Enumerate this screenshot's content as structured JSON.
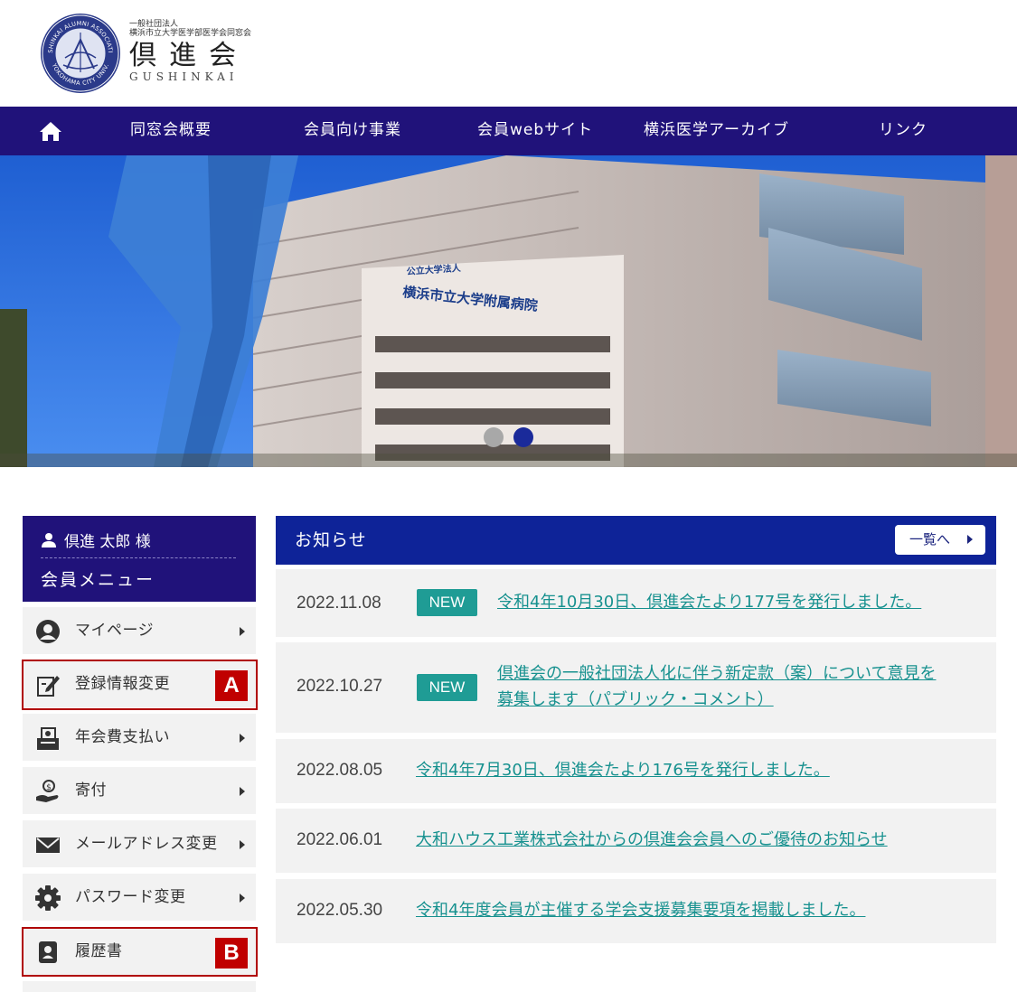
{
  "header": {
    "logo_seal_text_top": "GUSHINKAI ALUMNI ASSOCIATION",
    "logo_seal_text_bottom": "YOKOHAMA CITY UNIV.",
    "logo_sub_line1": "一般社団法人",
    "logo_sub_line2": "横浜市立大学医学部医学会同窓会",
    "logo_main": "倶進会",
    "logo_roman": "GUSHINKAI"
  },
  "nav": {
    "items": [
      {
        "label": "同窓会概要"
      },
      {
        "label": "会員向け事業"
      },
      {
        "label": "会員webサイト"
      },
      {
        "label": "横浜医学アーカイブ"
      },
      {
        "label": "リンク"
      }
    ]
  },
  "hero": {
    "sign_line1": "公立大学法人",
    "sign_line2": "横浜市立大学附属病院",
    "slides": 2,
    "active_slide": 2,
    "colors": {
      "dot_active": "#1a2a9a",
      "dot_inactive": "#a8a8a8"
    }
  },
  "sidebar": {
    "user": "倶進 太郎 様",
    "title": "会員メニュー",
    "items": [
      {
        "label": "マイページ",
        "icon": "user-circle-icon",
        "arrow": true
      },
      {
        "label": "登録情報変更",
        "icon": "edit-document-icon",
        "arrow": false,
        "marker": "A"
      },
      {
        "label": "年会費支払い",
        "icon": "payment-icon",
        "arrow": true
      },
      {
        "label": "寄付",
        "icon": "donation-icon",
        "arrow": true
      },
      {
        "label": "メールアドレス変更",
        "icon": "mail-icon",
        "arrow": true
      },
      {
        "label": "パスワード変更",
        "icon": "gear-icon",
        "arrow": true
      },
      {
        "label": "履歴書",
        "icon": "resume-icon",
        "arrow": false,
        "marker": "B"
      }
    ]
  },
  "news": {
    "title": "お知らせ",
    "more_label": "一覧へ",
    "new_label": "NEW",
    "items": [
      {
        "date": "2022.11.08",
        "new": true,
        "lines": [
          "令和4年10月30日、倶進会たより177号を発行しました。"
        ]
      },
      {
        "date": "2022.10.27",
        "new": true,
        "lines": [
          "倶進会の一般社団法人化に伴う新定款（案）について意見を",
          "募集します（パブリック・コメント）"
        ]
      },
      {
        "date": "2022.08.05",
        "new": false,
        "lines": [
          "令和4年7月30日、倶進会たより176号を発行しました。"
        ]
      },
      {
        "date": "2022.06.01",
        "new": false,
        "lines": [
          "大和ハウス工業株式会社からの倶進会会員へのご優待のお知らせ"
        ]
      },
      {
        "date": "2022.05.30",
        "new": false,
        "lines": [
          "令和4年度会員が主催する学会支援募集要項を掲載しました。"
        ]
      }
    ]
  },
  "colors": {
    "nav_bg": "#20127a",
    "news_header_bg": "#0e2398",
    "new_badge": "#1f9c95",
    "link": "#17918f",
    "marker": "#c00000"
  }
}
